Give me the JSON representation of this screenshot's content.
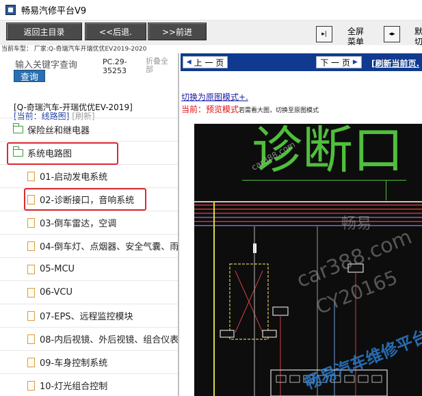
{
  "window": {
    "title": "畅易汽修平台V9"
  },
  "toolbar": {
    "back_main": "返回主目录",
    "back": "<<后退.",
    "forward": ">>前进",
    "fullscreen_1": "全屏",
    "fullscreen_2": "菜单",
    "edge_1": "默",
    "edge_2": "切"
  },
  "current_car": "当前车型： 厂家:Q-奇瑞汽车开瑞优优EV2019-2020",
  "left": {
    "keyword_label": "输入关键字查询",
    "search_button": "查询",
    "pc_code": "PC.29-35253",
    "collapse_all": "折叠全部",
    "model": "[Q-奇瑞汽车-开瑞优优EV-2019]",
    "current_prefix": "[当前：线路图]",
    "refresh": "[刷新]",
    "folders": [
      {
        "label": "保险丝和继电器"
      },
      {
        "label": "系统电路图"
      }
    ],
    "items": [
      {
        "label": "01-启动发电系统"
      },
      {
        "label": "02-诊断接口，音响系统"
      },
      {
        "label": "03-倒车雷达，空调"
      },
      {
        "label": "04-倒车灯、点烟器、安全气囊、雨"
      },
      {
        "label": "05-MCU"
      },
      {
        "label": "06-VCU"
      },
      {
        "label": "07-EPS、远程监控模块"
      },
      {
        "label": "08-内后视镜、外后视镜、组合仪表"
      },
      {
        "label": "09-车身控制系统"
      },
      {
        "label": "10-灯光组合控制"
      }
    ]
  },
  "right": {
    "prev_page": "上 一 页",
    "next_page": "下 一 页",
    "refresh_page": "[刷新当前页.",
    "switch_link": "切换为原图模式+.",
    "preview_prefix": "当前：预览模式",
    "preview_hint": "若需看大图，切换至原图模式",
    "diagram_title": "诊断口",
    "wm_small": "car388.com",
    "wm_1": "畅易",
    "wm_2": "car388.com",
    "wm_3": "CY20165",
    "wm_4": "畅易汽车维修平台"
  },
  "colors": {
    "accent_blue": "#0f3a8f",
    "highlight_red": "#d9292f",
    "folder_green": "#3c9a3c"
  }
}
